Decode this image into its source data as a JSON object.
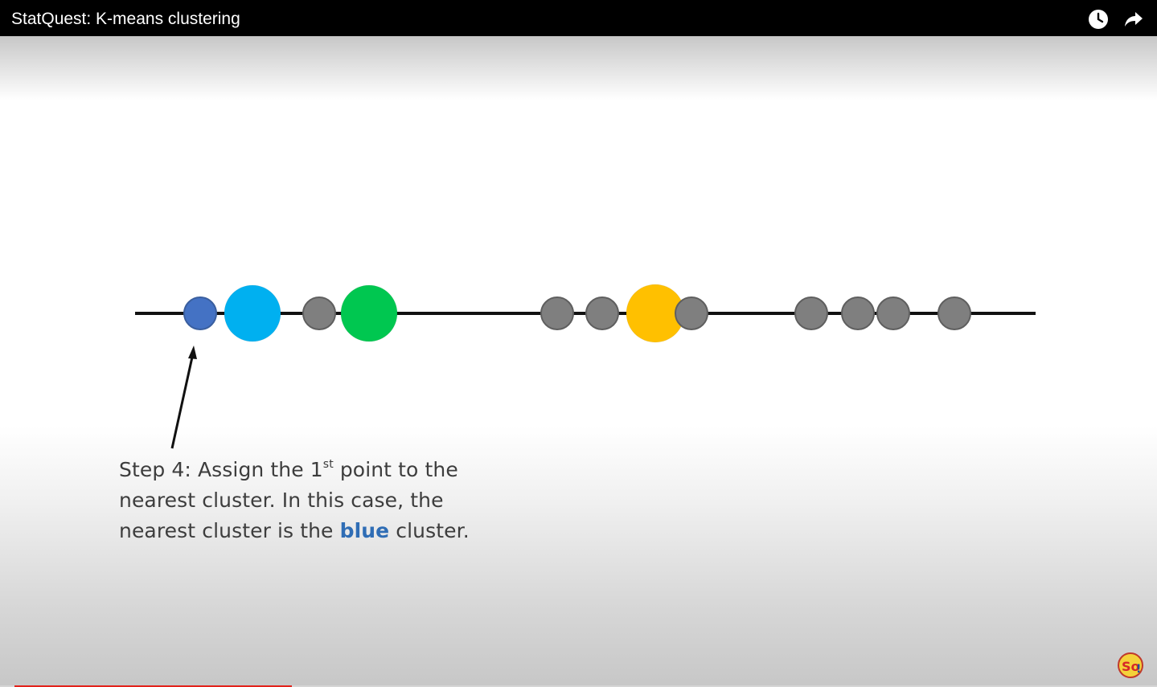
{
  "header": {
    "title": "StatQuest: K-means clustering",
    "watch_later_icon": "clock-icon",
    "share_icon": "share-arrow-icon"
  },
  "slide": {
    "caption": {
      "line1_pre": "Step 4: Assign the 1",
      "line1_sup": "st",
      "line1_post": " point to the",
      "line2": "nearest cluster. In this case, the",
      "line3_pre": "nearest cluster is the ",
      "line3_highlight": "blue",
      "line3_post": " cluster."
    },
    "points": [
      {
        "kind": "assigned-point",
        "color": "#4472c4"
      },
      {
        "kind": "centroid-blue",
        "color": "#00b0f0"
      },
      {
        "kind": "point",
        "color": "#7f7f7f"
      },
      {
        "kind": "centroid-green",
        "color": "#00c750"
      },
      {
        "kind": "point",
        "color": "#7f7f7f"
      },
      {
        "kind": "point",
        "color": "#7f7f7f"
      },
      {
        "kind": "centroid-yellow",
        "color": "#ffc000"
      },
      {
        "kind": "point",
        "color": "#7f7f7f"
      },
      {
        "kind": "point",
        "color": "#7f7f7f"
      },
      {
        "kind": "point",
        "color": "#7f7f7f"
      },
      {
        "kind": "point",
        "color": "#7f7f7f"
      },
      {
        "kind": "point",
        "color": "#7f7f7f"
      }
    ]
  },
  "colors": {
    "title_bar": "#000000",
    "progress": "#e3221b",
    "highlight": "#2f6db5",
    "text": "#3d3d3d"
  },
  "player": {
    "logo_icon": "statquest-logo-icon",
    "progress_fraction": 0.24
  }
}
